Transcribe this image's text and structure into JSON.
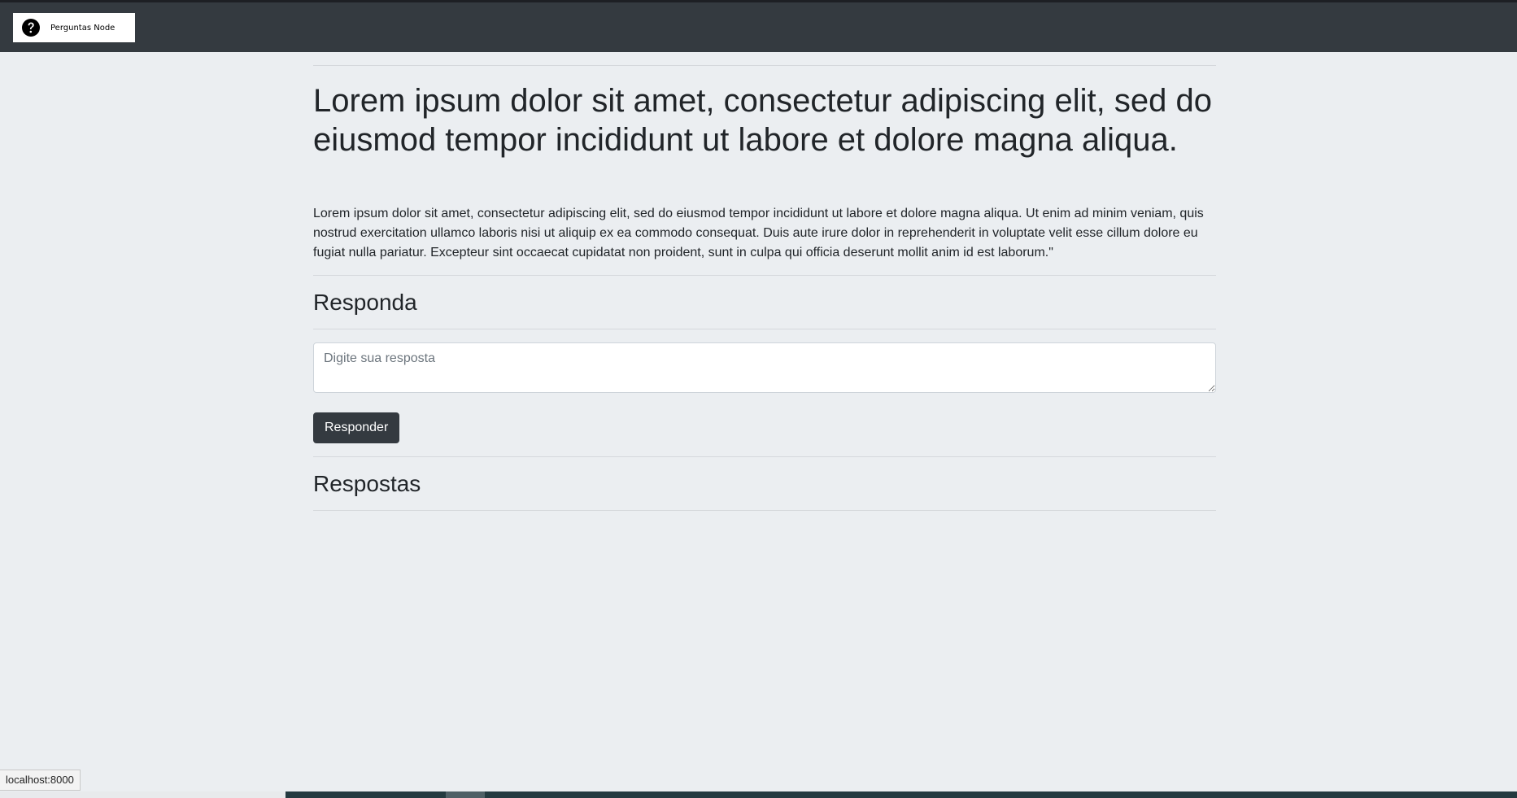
{
  "navbar": {
    "brand_label": "Perguntas Node",
    "brand_icon": "question-circle-icon"
  },
  "question": {
    "title": "Lorem ipsum dolor sit amet, consectetur adipiscing elit, sed do eiusmod tempor incididunt ut labore et dolore magna aliqua.",
    "description": "Lorem ipsum dolor sit amet, consectetur adipiscing elit, sed do eiusmod tempor incididunt ut labore et dolore magna aliqua. Ut enim ad minim veniam, quis nostrud exercitation ullamco laboris nisi ut aliquip ex ea commodo consequat. Duis aute irure dolor in reprehenderit in voluptate velit esse cillum dolore eu fugiat nulla pariatur. Excepteur sint occaecat cupidatat non proident, sunt in culpa qui officia deserunt mollit anim id est laborum.\""
  },
  "answer_form": {
    "heading": "Responda",
    "placeholder": "Digite sua resposta",
    "value": "",
    "submit_label": "Responder"
  },
  "answers": {
    "heading": "Respostas",
    "items": []
  },
  "status_bar": {
    "url": "localhost:8000"
  },
  "colors": {
    "navbar_bg": "#343a40",
    "page_bg": "#ebeef1",
    "button_bg": "#343a40",
    "text": "#212529"
  }
}
